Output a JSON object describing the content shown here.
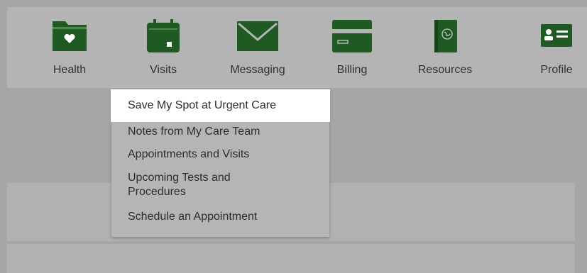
{
  "colors": {
    "accent": "#1f5a22",
    "overlay": "#a6a6a6",
    "highlight": "#ffffff"
  },
  "nav": {
    "items": [
      {
        "label": "Health",
        "icon": "folder-heart-icon"
      },
      {
        "label": "Visits",
        "icon": "calendar-icon"
      },
      {
        "label": "Messaging",
        "icon": "envelope-icon"
      },
      {
        "label": "Billing",
        "icon": "credit-card-icon"
      },
      {
        "label": "Resources",
        "icon": "book-globe-icon"
      },
      {
        "label": "Profile",
        "icon": "id-card-icon"
      }
    ]
  },
  "visits_menu": {
    "items": [
      {
        "label": "Save My Spot at Urgent Care"
      },
      {
        "label": "Notes from My Care Team"
      },
      {
        "label": "Appointments and Visits"
      },
      {
        "label": "Upcoming Tests and Procedures"
      },
      {
        "label": "Schedule an Appointment"
      }
    ]
  }
}
